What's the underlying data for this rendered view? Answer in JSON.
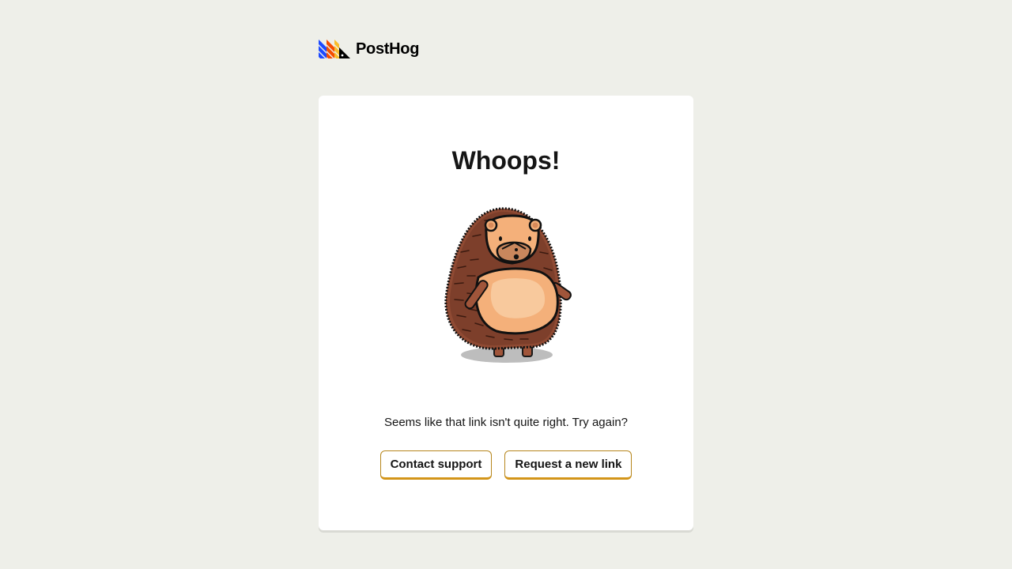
{
  "brand": {
    "name": "PostHog",
    "logo_icon": "posthog-logo-icon"
  },
  "error_card": {
    "title": "Whoops!",
    "illustration": "hedgehog-illustration",
    "message": "Seems like that link isn't quite right. Try again?",
    "actions": {
      "contact_support_label": "Contact support",
      "request_new_link_label": "Request a new link"
    }
  },
  "colors": {
    "background": "#eeefe9",
    "card": "#ffffff",
    "button_border": "#d39519",
    "logo_blue": "#1d4aff",
    "logo_orange": "#f54e00",
    "logo_yellow": "#f9bd2b"
  }
}
